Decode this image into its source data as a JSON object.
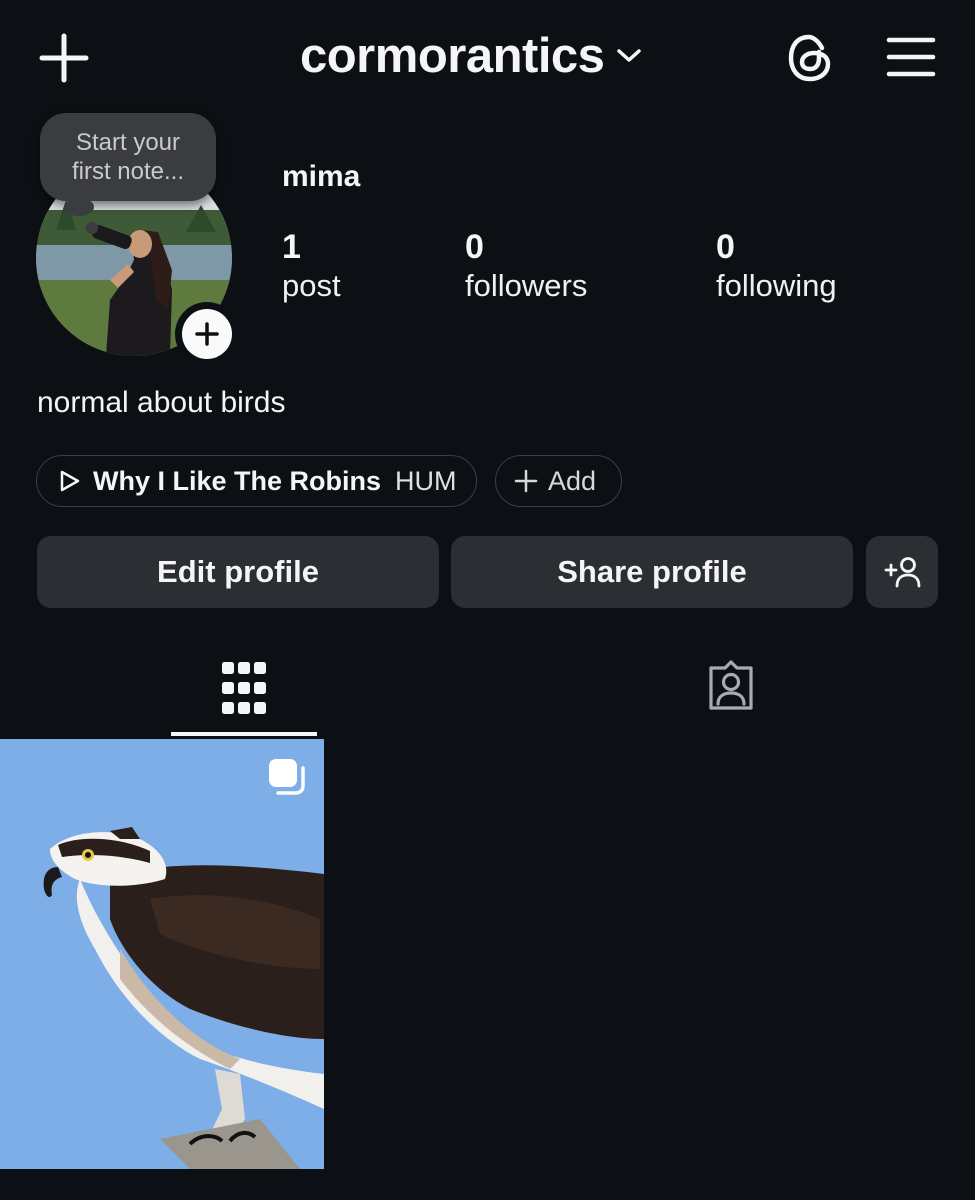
{
  "header": {
    "username": "cormorantics",
    "new_post_icon": "plus-icon",
    "username_chevron_icon": "chevron-down-icon",
    "threads_icon": "threads-icon",
    "menu_icon": "hamburger-menu-icon"
  },
  "profile": {
    "note_placeholder_line1": "Start your",
    "note_placeholder_line2": "first note...",
    "display_name": "mima",
    "stats": [
      {
        "value": "1",
        "label": "post"
      },
      {
        "value": "0",
        "label": "followers"
      },
      {
        "value": "0",
        "label": "following"
      }
    ],
    "bio": "normal about birds"
  },
  "music": {
    "title": "Why I Like The Robins",
    "artist": "HUM",
    "icon": "play-icon"
  },
  "add_pill": {
    "label": "Add",
    "icon": "plus-icon"
  },
  "actions": {
    "edit_label": "Edit profile",
    "share_label": "Share profile",
    "add_user_icon": "add-person-icon"
  },
  "tabs": [
    {
      "name": "posts-grid",
      "icon": "grid-icon",
      "active": true
    },
    {
      "name": "tagged",
      "icon": "tagged-person-icon",
      "active": false
    }
  ],
  "posts": [
    {
      "subject": "osprey",
      "carousel": true,
      "icon": "carousel-icon"
    }
  ],
  "colors": {
    "background": "#0c1014",
    "button": "#2b2e33",
    "text": "#f5f5f5",
    "sky": "#7eaee8"
  }
}
